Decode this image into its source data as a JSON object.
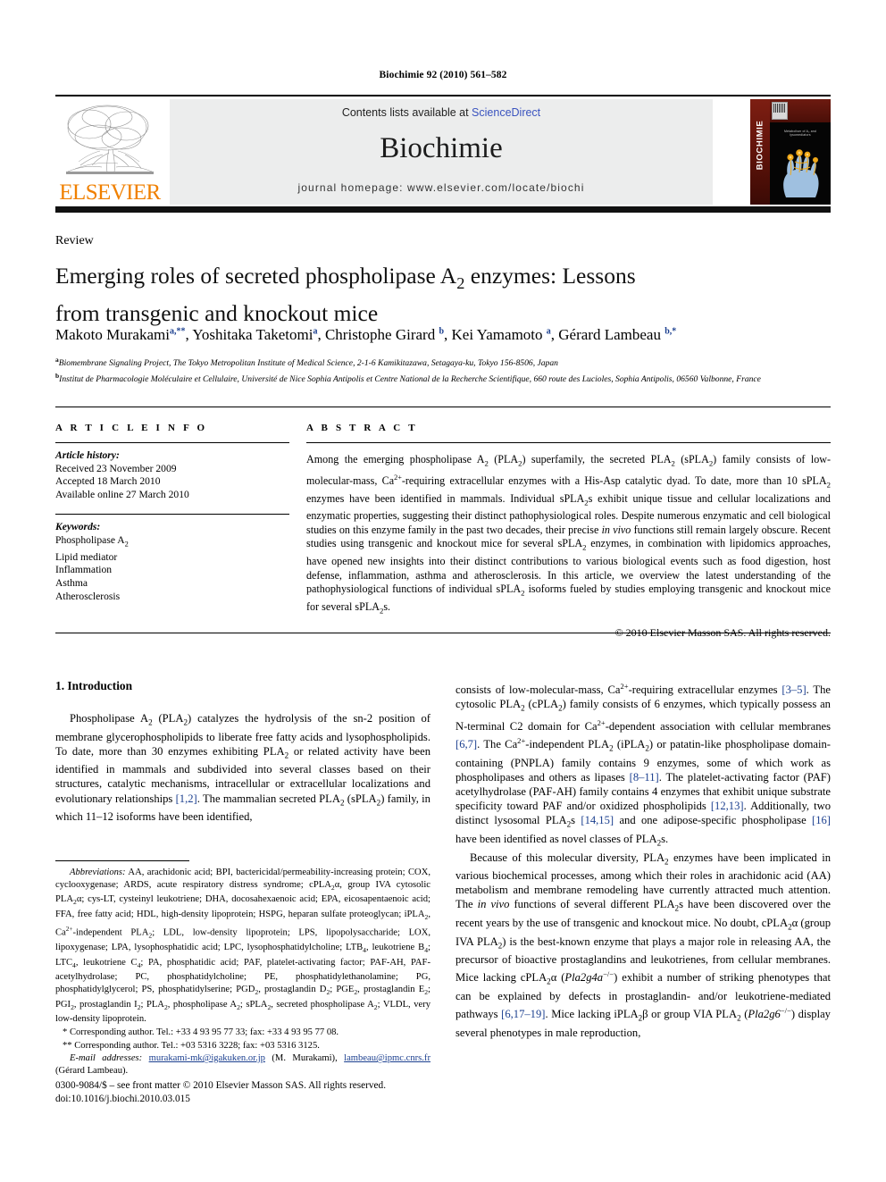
{
  "running_head": "Biochimie 92 (2010) 561–582",
  "masthead": {
    "contents_prefix": "Contents lists available at ",
    "sciencedirect_label": "ScienceDirect",
    "journal_title": "Biochimie",
    "homepage_line": "journal homepage: www.elsevier.com/locate/biochi",
    "publisher_wordmark": "ELSEVIER",
    "cover_spine_text": "BIOCHIMIE",
    "cover_caption": "Metabolism of A₂ and lysomediators",
    "link_color": "#3a53bf",
    "wordmark_color": "#f08000",
    "cover_spine_color": "#5d1209"
  },
  "article": {
    "type": "Review",
    "title_line1": "Emerging roles of secreted phospholipase A",
    "title_sub1": "2",
    "title_line1b": " enzymes: Lessons",
    "title_line2": "from transgenic and knockout mice",
    "authors": [
      {
        "name": "Makoto Murakami",
        "marks": "a,**"
      },
      {
        "name": "Yoshitaka Taketomi",
        "marks": "a"
      },
      {
        "name": "Christophe Girard",
        "marks": "b"
      },
      {
        "name": "Kei Yamamoto",
        "marks": "a"
      },
      {
        "name": "Gérard Lambeau",
        "marks": "b,*"
      }
    ],
    "affiliations": [
      {
        "mark": "a",
        "text": "Biomembrane Signaling Project, The Tokyo Metropolitan Institute of Medical Science, 2-1-6 Kamikitazawa, Setagaya-ku, Tokyo 156-8506, Japan"
      },
      {
        "mark": "b",
        "text": "Institut de Pharmacologie Moléculaire et Cellulaire, Université de Nice Sophia Antipolis et Centre National de la Recherche Scientifique, 660 route des Lucioles, Sophia Antipolis, 06560 Valbonne, France"
      }
    ]
  },
  "article_info": {
    "heading": "A R T I C L E  I N F O",
    "history_label": "Article history:",
    "history": [
      "Received 23 November 2009",
      "Accepted 18 March 2010",
      "Available online 27 March 2010"
    ],
    "keywords_label": "Keywords:",
    "keywords": [
      "Phospholipase A2",
      "Lipid mediator",
      "Inflammation",
      "Asthma",
      "Atherosclerosis"
    ]
  },
  "abstract": {
    "heading": "A B S T R A C T",
    "body": "Among the emerging phospholipase A2 (PLA2) superfamily, the secreted PLA2 (sPLA2) family consists of low-molecular-mass, Ca2+-requiring extracellular enzymes with a His-Asp catalytic dyad. To date, more than 10 sPLA2 enzymes have been identified in mammals. Individual sPLA2s exhibit unique tissue and cellular localizations and enzymatic properties, suggesting their distinct pathophysiological roles. Despite numerous enzymatic and cell biological studies on this enzyme family in the past two decades, their precise in vivo functions still remain largely obscure. Recent studies using transgenic and knockout mice for several sPLA2 enzymes, in combination with lipidomics approaches, have opened new insights into their distinct contributions to various biological events such as food digestion, host defense, inflammation, asthma and atherosclerosis. In this article, we overview the latest understanding of the pathophysiological functions of individual sPLA2 isoforms fueled by studies employing transgenic and knockout mice for several sPLA2s.",
    "copyright": "© 2010 Elsevier Masson SAS. All rights reserved."
  },
  "introduction": {
    "heading": "1. Introduction",
    "paragraph1": "Phospholipase A2 (PLA2) catalyzes the hydrolysis of the sn-2 position of membrane glycerophospholipids to liberate free fatty acids and lysophospholipids. To date, more than 30 enzymes exhibiting PLA2 or related activity have been identified in mammals and subdivided into several classes based on their structures, catalytic mechanisms, intracellular or extracellular localizations and evolutionary relationships [1,2]. The mammalian secreted PLA2 (sPLA2) family, in which 11–12 isoforms have been identified, consists of low-molecular-mass, Ca2+-requiring extracellular enzymes [3–5]. The cytosolic PLA2 (cPLA2) family consists of 6 enzymes, which typically possess an N-terminal C2 domain for Ca2+-dependent association with cellular membranes [6,7]. The Ca2+-independent PLA2 (iPLA2) or patatin-like phospholipase domain-containing (PNPLA) family contains 9 enzymes, some of which work as phospholipases and others as lipases [8–11]. The platelet-activating factor (PAF) acetylhydrolase (PAF-AH) family contains 4 enzymes that exhibit unique substrate specificity toward PAF and/or oxidized phospholipids [12,13]. Additionally, two distinct lysosomal PLA2s [14,15] and one adipose-specific phospholipase [16] have been identified as novel classes of PLA2s.",
    "paragraph2": "Because of this molecular diversity, PLA2 enzymes have been implicated in various biochemical processes, among which their roles in arachidonic acid (AA) metabolism and membrane remodeling have currently attracted much attention. The in vivo functions of several different PLA2s have been discovered over the recent years by the use of transgenic and knockout mice. No doubt, cPLA2α (group IVA PLA2) is the best-known enzyme that plays a major role in releasing AA, the precursor of bioactive prostaglandins and leukotrienes, from cellular membranes. Mice lacking cPLA2α (Pla2g4a−/−) exhibit a number of striking phenotypes that can be explained by defects in prostaglandin- and/or leukotriene-mediated pathways [6,17–19]. Mice lacking iPLA2β or group VIA PLA2 (Pla2g6−/−) display several phenotypes in male reproduction,"
  },
  "footnotes": {
    "abbreviations_label": "Abbreviations:",
    "abbreviations_text": "AA, arachidonic acid; BPI, bactericidal/permeability-increasing protein; COX, cyclooxygenase; ARDS, acute respiratory distress syndrome; cPLA2α, group IVA cytosolic PLA2α; cys-LT, cysteinyl leukotriene; DHA, docosahexaenoic acid; EPA, eicosapentaenoic acid; FFA, free fatty acid; HDL, high-density lipoprotein; HSPG, heparan sulfate proteoglycan; iPLA2, Ca2+-independent PLA2; LDL, low-density lipoprotein; LPS, lipopolysaccharide; LOX, lipoxygenase; LPA, lysophosphatidic acid; LPC, lysophosphatidylcholine; LTB4, leukotriene B4; LTC4, leukotriene C4; PA, phosphatidic acid; PAF, platelet-activating factor; PAF-AH, PAF-acetylhydrolase; PC, phosphatidylcholine; PE, phosphatidylethanolamine; PG, phosphatidylglycerol; PS, phosphatidylserine; PGD2, prostaglandin D2; PGE2, prostaglandin E2; PGI2, prostaglandin I2; PLA2, phospholipase A2; sPLA2, secreted phospholipase A2; VLDL, very low-density lipoprotein.",
    "corresponding1": "* Corresponding author. Tel.: +33 4 93 95 77 33; fax: +33 4 93 95 77 08.",
    "corresponding2": "** Corresponding author. Tel.: +03 5316 3228; fax: +03 5316 3125.",
    "email_label": "E-mail addresses:",
    "email1": "murakami-mk@igakuken.or.jp",
    "email1_owner": "(M. Murakami),",
    "email2": "lambeau@ipmc.cnrs.fr",
    "email2_owner": "(Gérard Lambeau)."
  },
  "colophon": {
    "line1": "0300-9084/$ – see front matter © 2010 Elsevier Masson SAS. All rights reserved.",
    "line2": "doi:10.1016/j.biochi.2010.03.015"
  }
}
